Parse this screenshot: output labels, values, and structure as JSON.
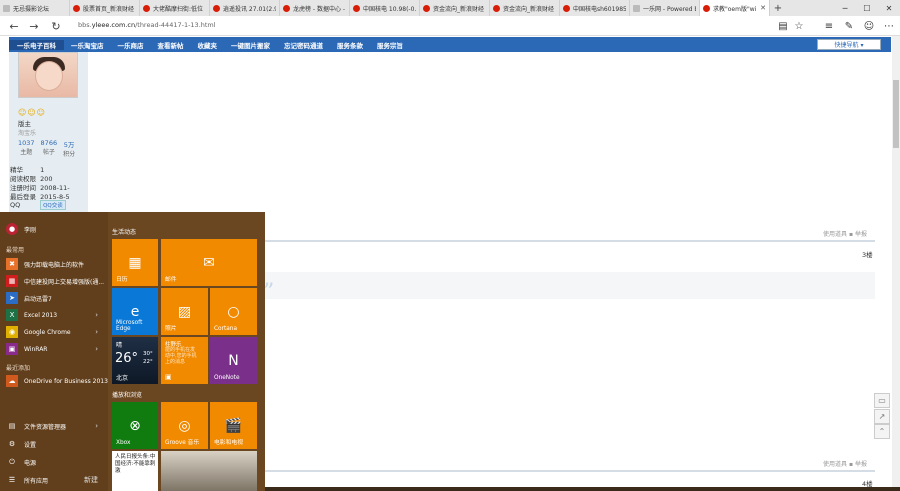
{
  "browser": {
    "tabs": [
      {
        "title": "无忌摄影论坛",
        "active": false
      },
      {
        "title": "股票首页_新浪财经",
        "active": false
      },
      {
        "title": "大佬酷摩扫街:低位",
        "active": false
      },
      {
        "title": "逍遥投讯 27.01(2.93",
        "active": false
      },
      {
        "title": "龙虎榜 - 数据中心 -",
        "active": false
      },
      {
        "title": "中国核电 10.98(-0.6",
        "active": false
      },
      {
        "title": "资金流向_新浪财经",
        "active": false
      },
      {
        "title": "资金流向_新浪财经",
        "active": false
      },
      {
        "title": "中国核电sh601985_",
        "active": false
      },
      {
        "title": "一乐网 - Powered b",
        "active": false
      },
      {
        "title": "求教\"oem版\"wi",
        "active": true
      }
    ],
    "url_prefix": "bbs.",
    "url_domain": "yleee.com.cn",
    "url_path": "/thread-44417-1-13.html"
  },
  "site_nav": {
    "items": [
      "一乐电子百科",
      "一乐淘宝店",
      "一乐商店",
      "查看新帖",
      "收藏夹",
      "一键图片搬家",
      "忘记密码通道",
      "服务条款",
      "服务宗旨"
    ],
    "quick_nav": "快捷导航 ▾"
  },
  "profile": {
    "medals": "☺☺☺",
    "role": "版主",
    "subtitle": "淘宝乐",
    "stats": [
      {
        "value": "1037",
        "label": "主题"
      },
      {
        "value": "8766",
        "label": "帖子"
      },
      {
        "value": "5万",
        "label": "积分"
      }
    ],
    "info": [
      {
        "k": "精华",
        "v": "1"
      },
      {
        "k": "阅读权限",
        "v": "200"
      },
      {
        "k": "注册时间",
        "v": "2008-11-"
      },
      {
        "k": "最后登录",
        "v": "2015-8-5"
      }
    ],
    "qq_label": "QQ",
    "qq_badge": "QQ交谈"
  },
  "posts": {
    "footer_left": "使用道具",
    "footer_sep": "▪",
    "footer_right": "举报",
    "floor3": "3楼",
    "floor4": "4楼"
  },
  "start_menu": {
    "user": "李刚",
    "most_used_label": "最常用",
    "most_used": [
      {
        "label": "强力卸载电脑上的软件",
        "icon": "uninstall-icon",
        "color": "#e8712a",
        "arrow": false
      },
      {
        "label": "中信建投网上交易增强版(通...",
        "icon": "stock-app-icon",
        "color": "#d01e1e",
        "arrow": false
      },
      {
        "label": "启动迅雷7",
        "icon": "thunder-icon",
        "color": "#2b6cc4",
        "arrow": false
      },
      {
        "label": "Excel 2013",
        "icon": "excel-icon",
        "color": "#1e7145",
        "arrow": true
      },
      {
        "label": "Google Chrome",
        "icon": "chrome-icon",
        "color": "#e0b000",
        "arrow": true
      },
      {
        "label": "WinRAR",
        "icon": "winrar-icon",
        "color": "#8a2a8a",
        "arrow": true
      }
    ],
    "recent_label": "最近添加",
    "recent": [
      {
        "label": "OneDrive for Business 2013",
        "icon": "onedrive-icon",
        "color": "#d05a1e"
      }
    ],
    "bottom": [
      {
        "label": "文件资源管理器",
        "icon": "folder-icon",
        "arrow": true
      },
      {
        "label": "设置",
        "icon": "gear-icon",
        "arrow": false
      },
      {
        "label": "电源",
        "icon": "power-icon",
        "arrow": false
      },
      {
        "label": "所有应用",
        "icon": "apps-icon",
        "arrow": false,
        "badge": "新建"
      }
    ],
    "group1_label": "生活动态",
    "group2_label": "播放和浏览",
    "tiles": {
      "calendar": "日历",
      "mail": "邮件",
      "edge": "Microsoft Edge",
      "photos": "照片",
      "cortana": "Cortana",
      "weather_cond": "晴",
      "weather_temp": "26°",
      "weather_hi": "30°",
      "weather_lo": "22°",
      "weather_city": "北京",
      "store_title": "柱野乐",
      "store_text": "能的手机在发\n动中,您的手机\n上的消息",
      "onenote": "OneNote",
      "xbox": "Xbox",
      "groove": "Groove 音乐",
      "movies": "电影和电视",
      "news": "人民日报头条:中国经济:不能靠刺激"
    }
  }
}
